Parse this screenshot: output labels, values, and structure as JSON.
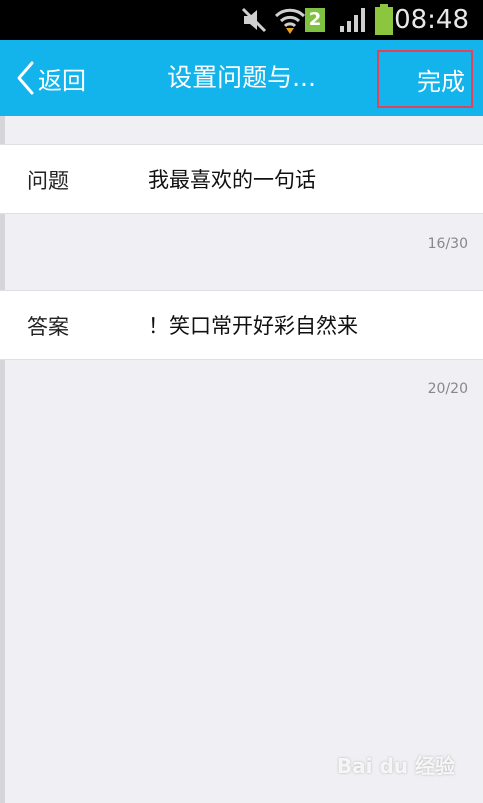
{
  "status_bar": {
    "time": "08:48",
    "notification_badge": "2",
    "icons": [
      "mute-icon",
      "wifi-icon",
      "signal-icon",
      "battery-icon"
    ],
    "battery_color": "#8cc63f"
  },
  "nav": {
    "back_label": "返回",
    "title": "设置问题与...",
    "done_label": "完成",
    "bar_color": "#13b3ec",
    "highlight_color": "#e0435a"
  },
  "question": {
    "label": "问题",
    "value": "我最喜欢的一句话",
    "counter": "16/30"
  },
  "answer": {
    "label": "答案",
    "value": "！笑口常开好彩自然来",
    "counter": "20/20"
  },
  "watermark": "Bai du 经验"
}
